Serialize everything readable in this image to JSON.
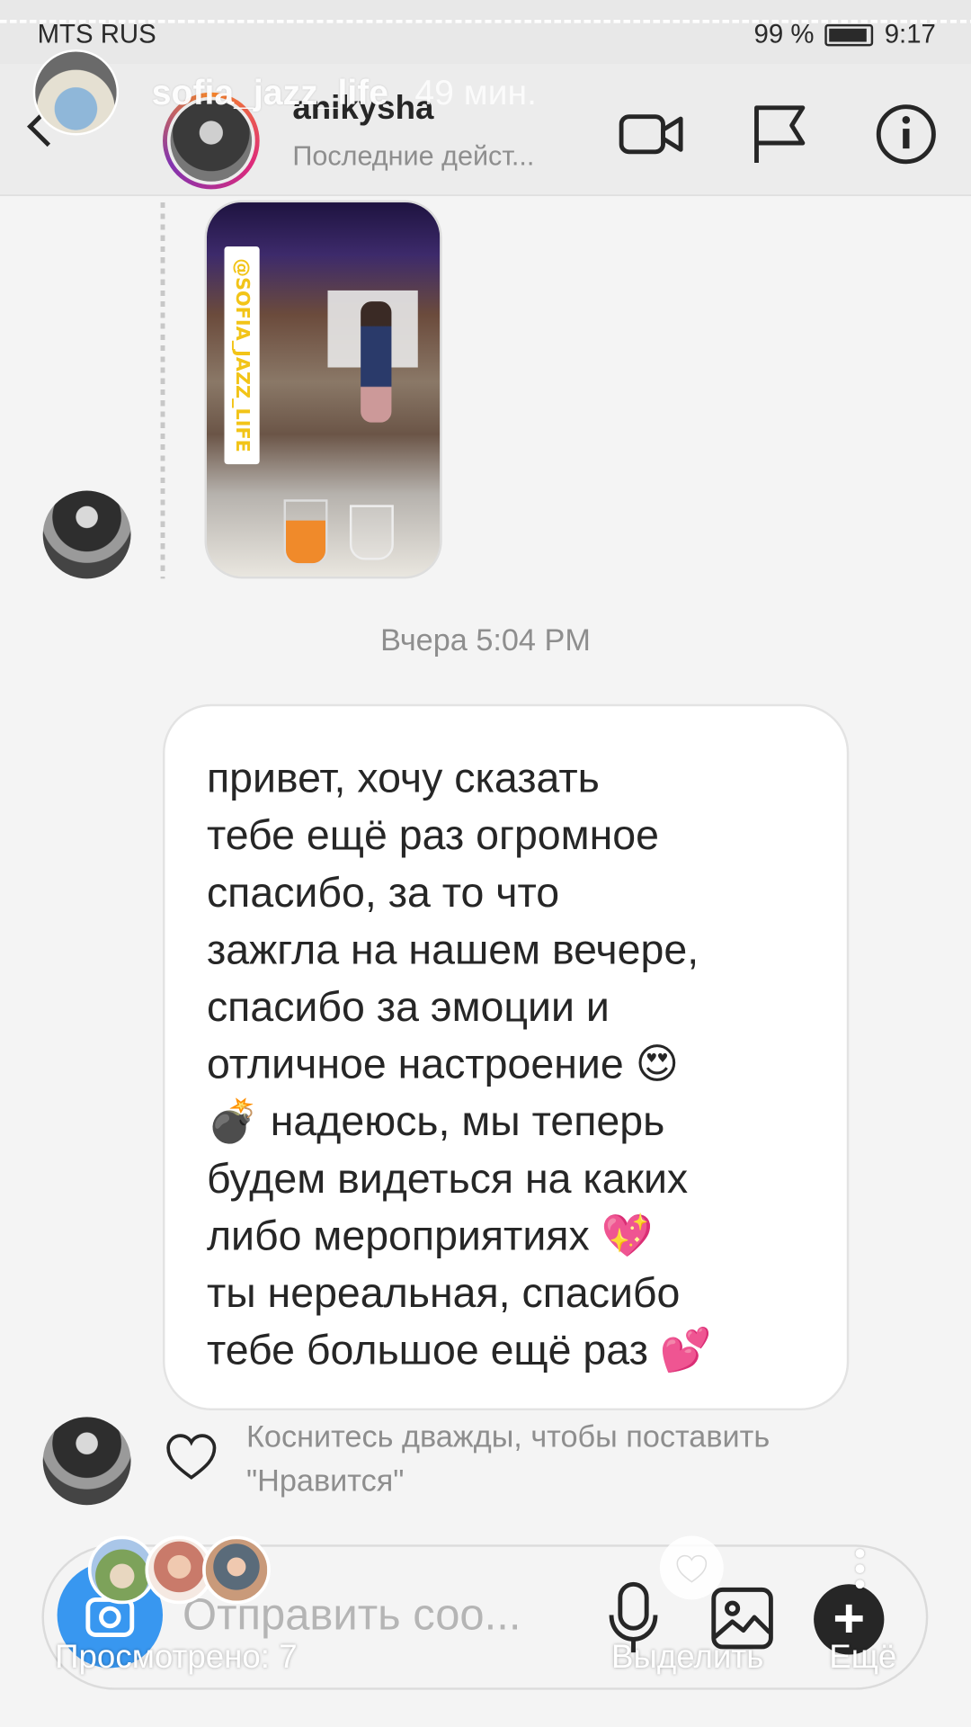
{
  "status_bar": {
    "carrier": "MTS RUS",
    "battery": "99 %",
    "time": "9:17"
  },
  "story": {
    "username": "sofia_jazz_life",
    "time_ago": "49 мин.",
    "thumb_tag": "@SOFIA_JAZZ_LIFE"
  },
  "header": {
    "thread_name": "anikysha",
    "thread_status": "Последние дейст..."
  },
  "messages": {
    "timestamp": "Вчера 5:04 PM",
    "text": "привет, хочу сказать\nтебе ещё раз огромное\nспасибо, за то что\nзажгла на нашем вечере,\nспасибо за эмоции и\nотличное настроение 😍\n💣 надеюсь, мы теперь\nбудем видеться на каких\nлибо мероприятиях 💖\nты нереальная, спасибо\nтебе большое ещё раз 💕",
    "like_hint": "Коснитесь дважды, чтобы поставить \"Нравится\""
  },
  "composer": {
    "placeholder": "Отправить соо..."
  },
  "story_footer": {
    "viewed": "Просмотрено: 7",
    "highlight": "Выделить",
    "more": "Ещё"
  },
  "colors": {
    "accent": "#3897f0",
    "text": "#262626",
    "muted": "#8e8e8e"
  }
}
